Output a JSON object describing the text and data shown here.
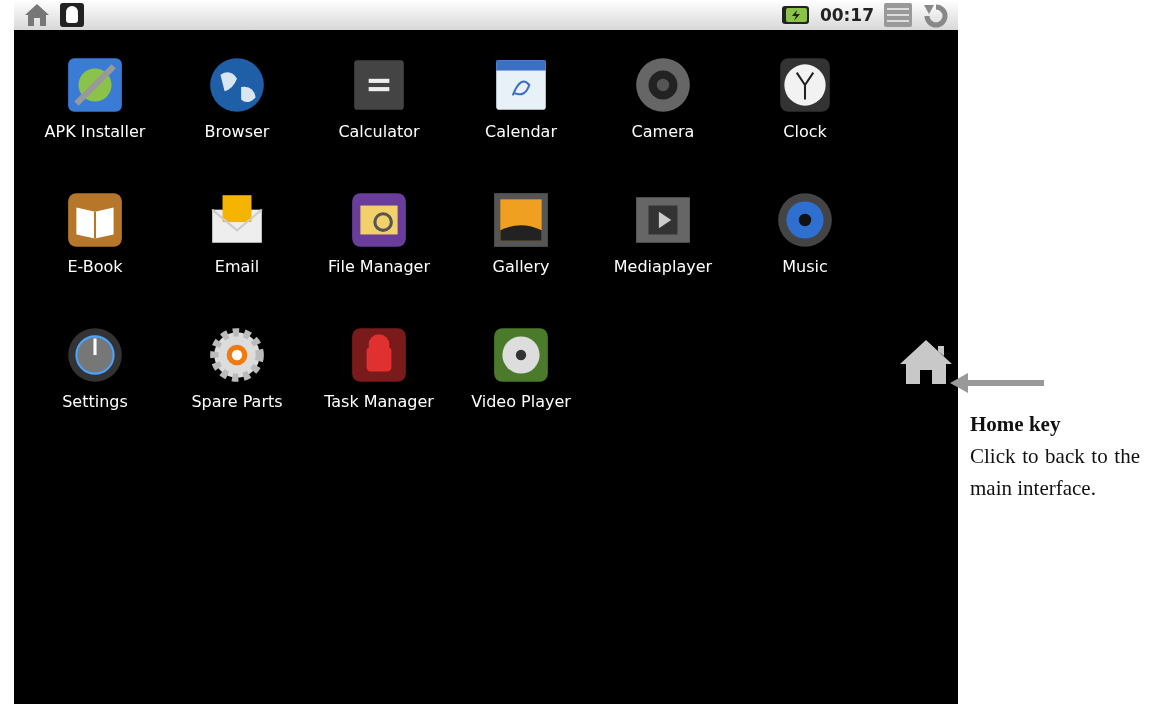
{
  "status_bar": {
    "time": "00:17"
  },
  "apps": [
    {
      "label": "APK Installer"
    },
    {
      "label": "Browser"
    },
    {
      "label": "Calculator"
    },
    {
      "label": "Calendar"
    },
    {
      "label": "Camera"
    },
    {
      "label": "Clock"
    },
    {
      "label": "E-Book"
    },
    {
      "label": "Email"
    },
    {
      "label": "File Manager"
    },
    {
      "label": "Gallery"
    },
    {
      "label": "Mediaplayer"
    },
    {
      "label": "Music"
    },
    {
      "label": "Settings"
    },
    {
      "label": "Spare Parts"
    },
    {
      "label": "Task Manager"
    },
    {
      "label": "Video Player"
    }
  ],
  "callout": {
    "title": "Home key",
    "text": "Click to back to the main interface."
  }
}
